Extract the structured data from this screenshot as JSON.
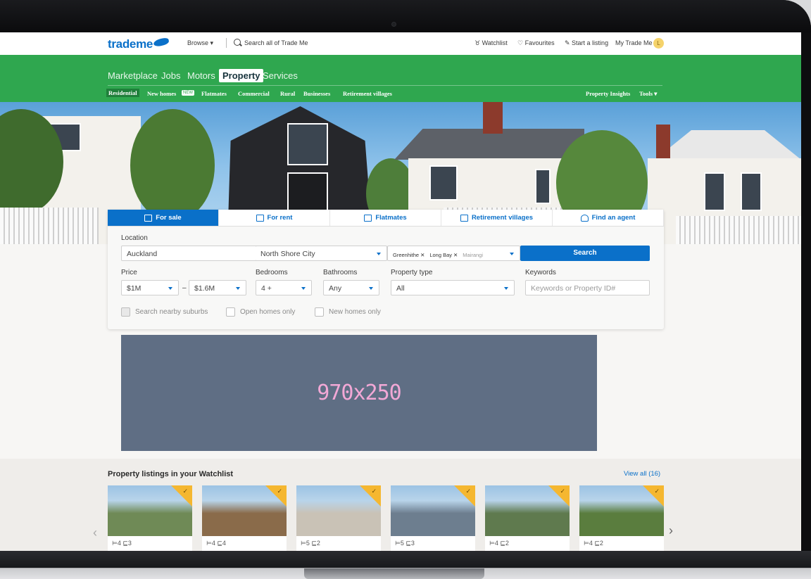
{
  "header": {
    "logo": "trademe",
    "browse": "Browse ▾",
    "search_all": "Search all of Trade Me",
    "watchlist": "Watchlist",
    "favourites": "Favourites",
    "start_listing": "Start a listing",
    "my_trade_me": "My Trade Me",
    "avatar_initial": "L"
  },
  "nav": {
    "main": [
      "Marketplace",
      "Jobs",
      "Motors",
      "Property",
      "Services"
    ],
    "sub": [
      "Residential",
      "New homes",
      "Flatmates",
      "Commercial",
      "Rural",
      "Businesses",
      "Retirement villages"
    ],
    "new_badge": "NEW",
    "property_insights": "Property Insights",
    "tools": "Tools ▾"
  },
  "search_panel": {
    "tabs": [
      "For sale",
      "For rent",
      "Flatmates",
      "Retirement villages",
      "Find an agent"
    ],
    "location_label": "Location",
    "region": "Auckland",
    "district": "North Shore City",
    "suburbs": [
      "Greenhithe",
      "Long Bay",
      "Mairangi"
    ],
    "search_button": "Search",
    "price_label": "Price",
    "price_min": "$1M",
    "price_max": "$1.6M",
    "bedrooms_label": "Bedrooms",
    "bedrooms": "4 +",
    "bathrooms_label": "Bathrooms",
    "bathrooms": "Any",
    "property_type_label": "Property type",
    "property_type": "All",
    "keywords_label": "Keywords",
    "keywords_placeholder": "Keywords or Property ID#",
    "checkboxes": [
      "Search nearby suburbs",
      "Open homes only",
      "New homes only"
    ]
  },
  "ad": {
    "label": "970x250"
  },
  "watchlist": {
    "title": "Property listings in your Watchlist",
    "view_all": "View all (16)",
    "cards": [
      {
        "beds": "4",
        "baths": "3",
        "image_color": "#6f8a56"
      },
      {
        "beds": "4",
        "baths": "4",
        "image_color": "#8a6b4a"
      },
      {
        "beds": "5",
        "baths": "2",
        "image_color": "#c9c2b6"
      },
      {
        "beds": "5",
        "baths": "3",
        "image_color": "#6d7e8f"
      },
      {
        "beds": "4",
        "baths": "2",
        "image_color": "#5f7a4e"
      },
      {
        "beds": "4",
        "baths": "2",
        "image_color": "#5a7d3e"
      }
    ]
  },
  "colors": {
    "green": "#2fa74f",
    "blue": "#0a70c9",
    "orange": "#f48c20",
    "flag": "#f5b730"
  }
}
